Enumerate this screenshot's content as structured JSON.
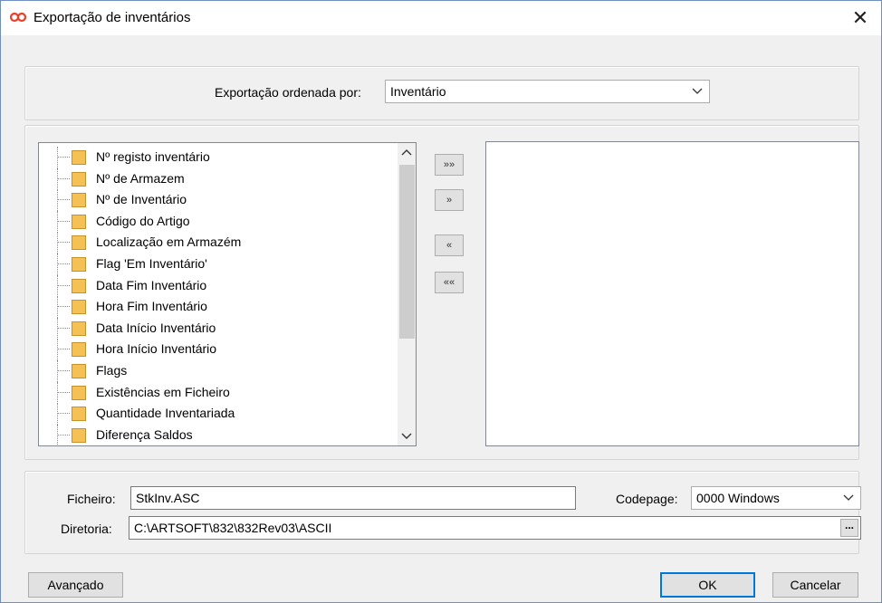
{
  "window": {
    "title": "Exportação de inventários",
    "close_glyph": "✕"
  },
  "sort": {
    "label": "Exportação ordenada por:",
    "value": "Inventário"
  },
  "available_fields": [
    "Nº registo inventário",
    "Nº de Armazem",
    "Nº de Inventário",
    "Código do Artigo",
    "Localização em Armazém",
    "Flag 'Em Inventário'",
    "Data Fim Inventário",
    "Hora Fim Inventário",
    "Data Início Inventário",
    "Hora Início Inventário",
    "Flags",
    "Existências em Ficheiro",
    "Quantidade Inventariada",
    "Diferença Saldos"
  ],
  "selected_fields": [],
  "move_buttons": {
    "add_all": "»»",
    "add_one": "»",
    "remove_one": "«",
    "remove_all": "««"
  },
  "file": {
    "label": "Ficheiro:",
    "value": "StkInv.ASC"
  },
  "codepage": {
    "label": "Codepage:",
    "value": "0000 Windows"
  },
  "directory": {
    "label": "Diretoria:",
    "value": "C:\\ARTSOFT\\832\\832Rev03\\ASCII",
    "browse_label": "..."
  },
  "footer": {
    "advanced": "Avançado",
    "ok": "OK",
    "cancel": "Cancelar"
  },
  "icons": {
    "app": "infinity-logo-icon",
    "close": "close-icon",
    "field": "field-square-icon"
  },
  "colors": {
    "accent": "#0078d7",
    "field_icon": "#f5c054",
    "app_icon": "#e8402a"
  }
}
